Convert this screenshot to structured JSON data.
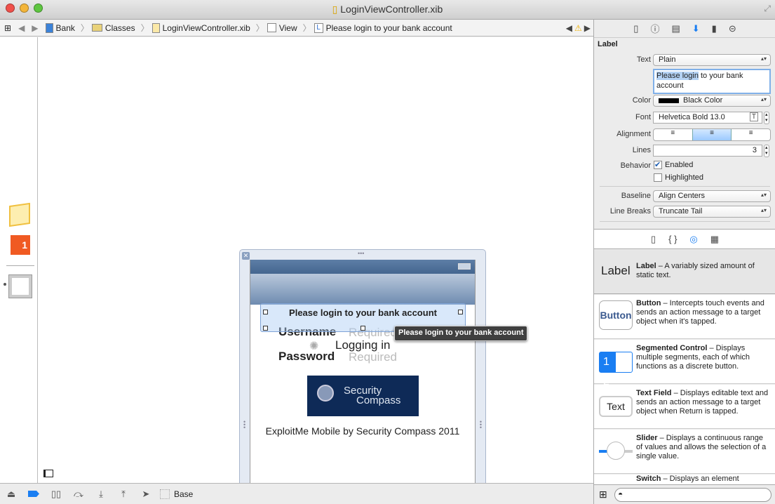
{
  "window": {
    "title": "LoginViewController.xib"
  },
  "jumpbar": {
    "crumbs": [
      "Bank",
      "Classes",
      "LoginViewController.xib",
      "View",
      "Please login to your bank account"
    ]
  },
  "inspector": {
    "section": "Label",
    "text_label": "Text",
    "text_type": "Plain",
    "text_value_selected": "Please login",
    "text_value_rest": " to your bank account",
    "color_label": "Color",
    "color_value": "Black Color",
    "font_label": "Font",
    "font_value": "Helvetica Bold 13.0",
    "alignment_label": "Alignment",
    "lines_label": "Lines",
    "lines_value": "3",
    "behavior_label": "Behavior",
    "enabled_label": "Enabled",
    "enabled": true,
    "highlighted_label": "Highlighted",
    "highlighted": false,
    "baseline_label": "Baseline",
    "baseline_value": "Align Centers",
    "linebreaks_label": "Line Breaks",
    "linebreaks_value": "Truncate Tail"
  },
  "library": {
    "items": [
      {
        "icon": "Label",
        "name": "Label",
        "desc": " – A variably sized amount of static text."
      },
      {
        "icon": "Button",
        "name": "Button",
        "desc": " – Intercepts touch events and sends an action message to a target object when it's tapped."
      },
      {
        "icon": "1 2",
        "name": "Segmented Control",
        "desc": " – Displays multiple segments, each of which functions as a discrete button."
      },
      {
        "icon": "Text",
        "name": "Text Field",
        "desc": " – Displays editable text and sends an action message to a target object when Return is tapped."
      },
      {
        "icon": "",
        "name": "Slider",
        "desc": " – Displays a continuous range of values and allows the selection of a single value."
      },
      {
        "icon": "",
        "name": "Switch",
        "desc": " – Displays an element"
      }
    ]
  },
  "phone": {
    "title_label": "Please login to your bank account",
    "tooltip": "Please login to your bank account",
    "username": "Username",
    "username_placeholder": "Required",
    "password": "Password",
    "password_placeholder": "Required",
    "logging_in": "Logging in",
    "logo_line1": "Security",
    "logo_line2": "Compass",
    "footer": "ExploitMe Mobile by Security Compass 2011"
  },
  "bottombar": {
    "base_label": "Base"
  },
  "colors": {
    "accent": "#1a7ef2",
    "navbar": "#4a6a92",
    "logo_bg": "#0e2a57"
  }
}
